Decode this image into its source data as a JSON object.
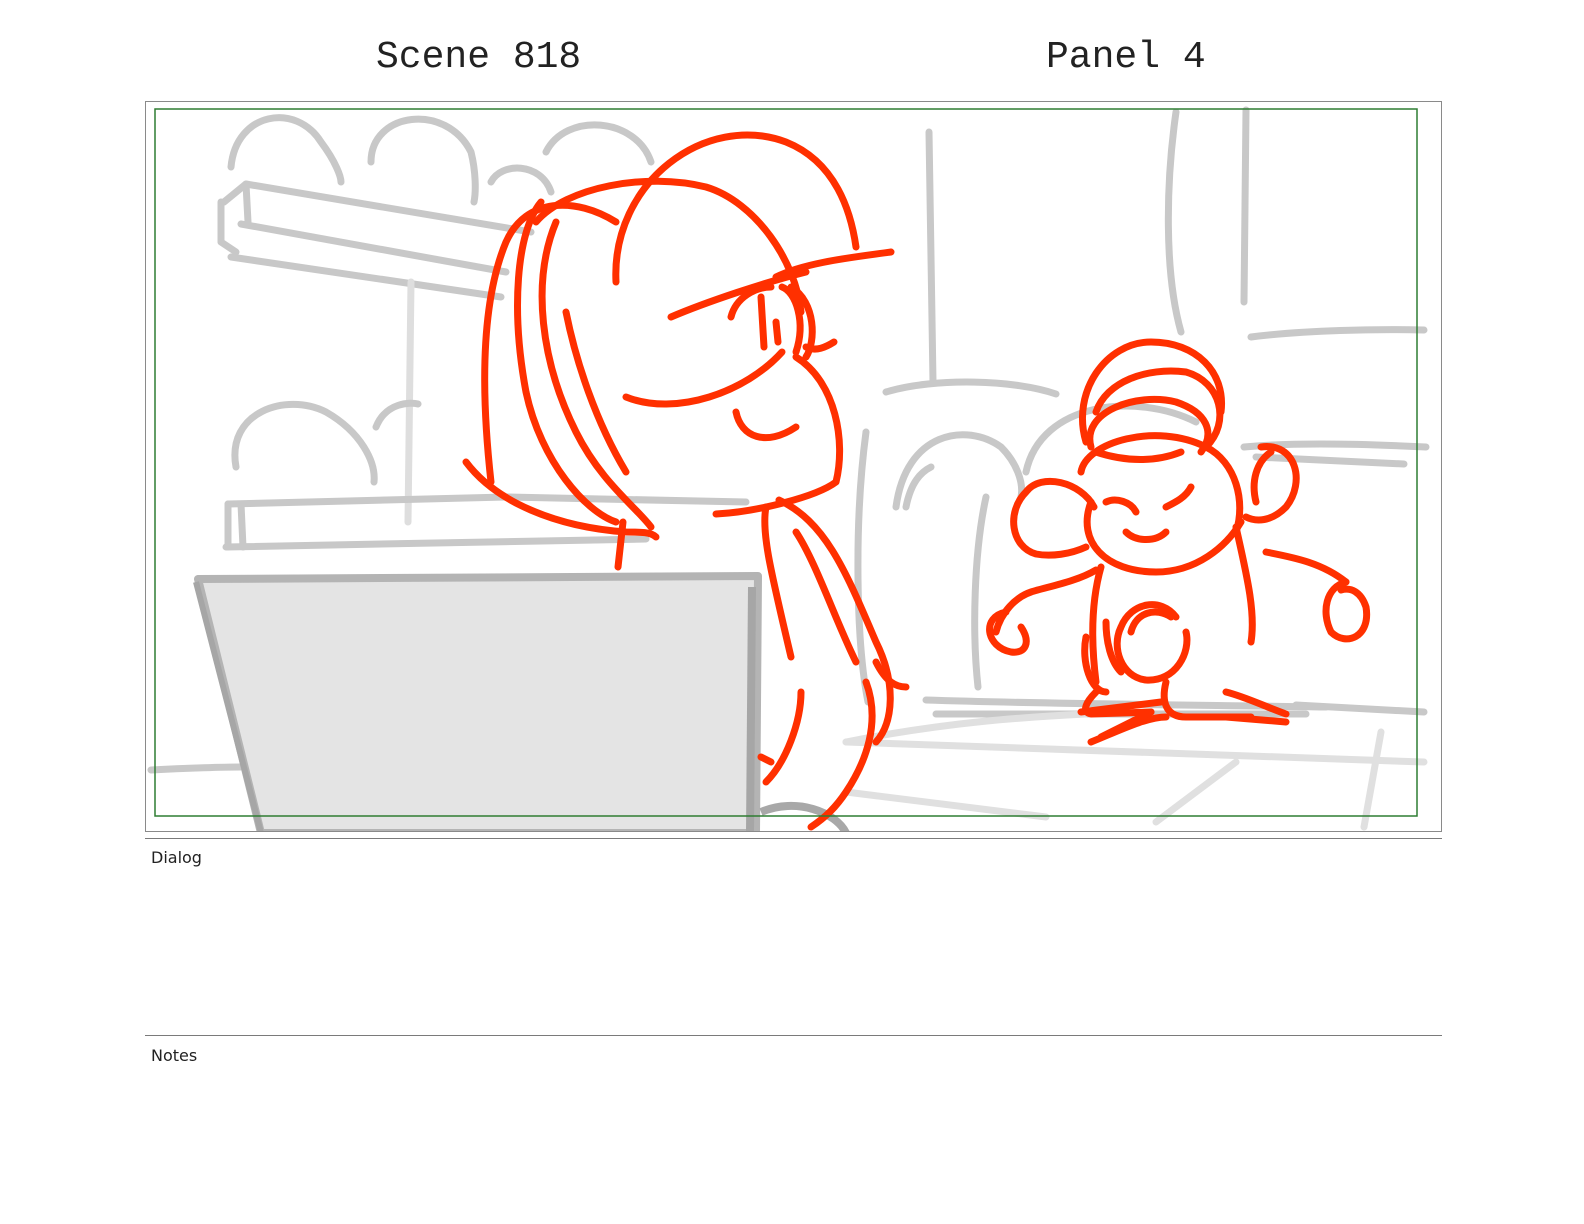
{
  "header": {
    "scene_label": "Scene 818",
    "panel_label": "Panel 4"
  },
  "sections": {
    "dialog": {
      "label": "Dialog",
      "text": ""
    },
    "notes": {
      "label": "Notes",
      "text": ""
    }
  },
  "colors": {
    "sketch_foreground": "#ff3000",
    "sketch_background": "#c8c8c8",
    "safe_frame": "#2e7d32",
    "panel_border": "#8a8a8a"
  }
}
